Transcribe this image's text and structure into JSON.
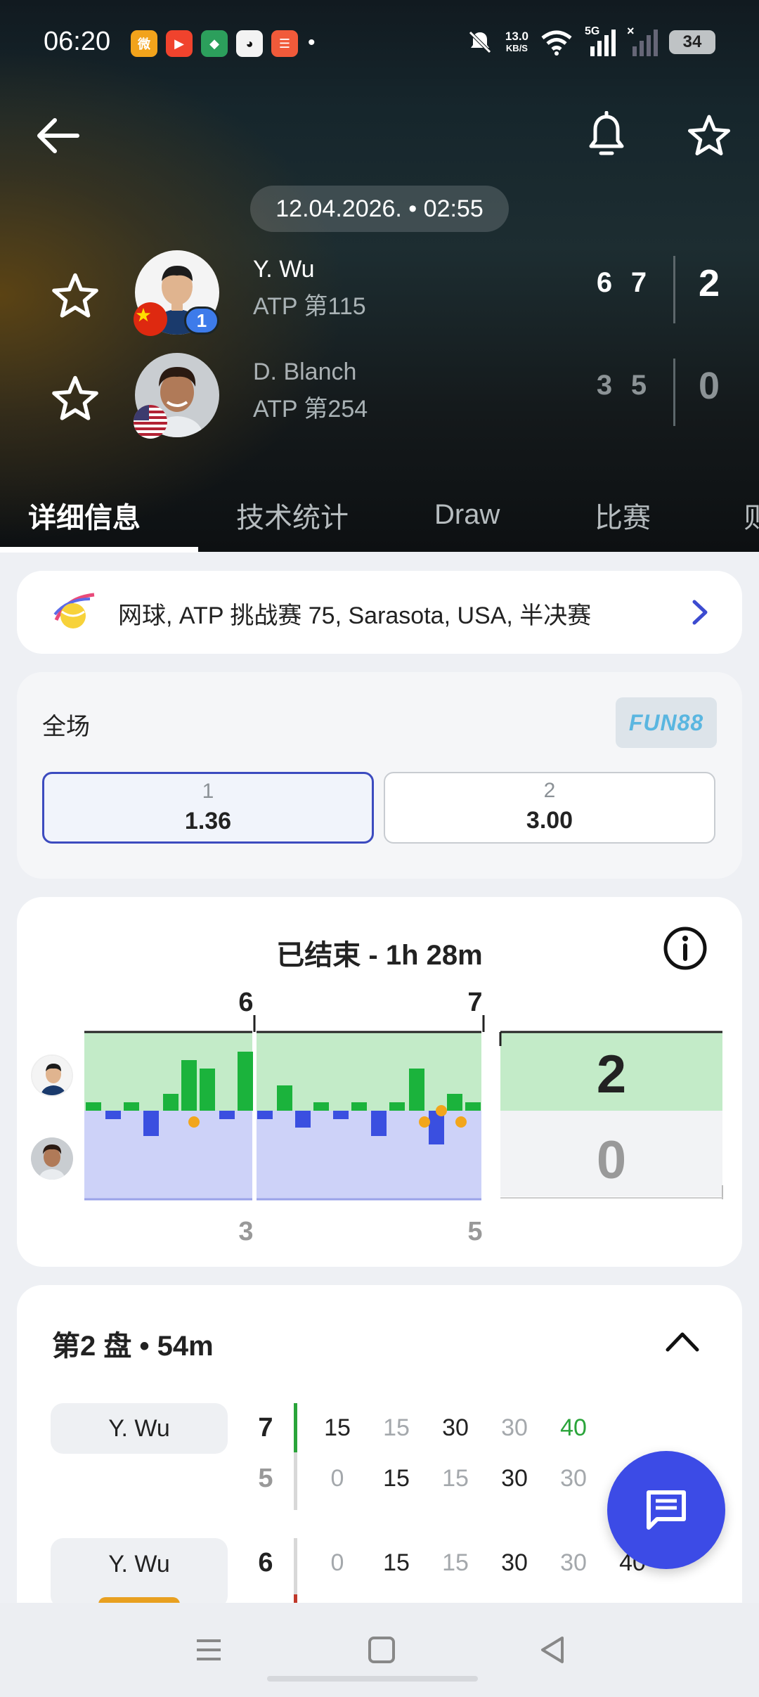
{
  "status_bar": {
    "time": "06:20",
    "apps": [
      "weibo-icon",
      "video-app-icon",
      "game-app-icon",
      "qq-icon",
      "xiaohongshu-icon"
    ],
    "net_speed_value": "13.0",
    "net_speed_unit": "KB/S",
    "network": "5G",
    "battery": "34"
  },
  "header": {
    "date": "12.04.2026. • 02:55"
  },
  "players": [
    {
      "name": "Y. Wu",
      "rank": "ATP 第115",
      "seed": "1",
      "flag": "china",
      "sets": [
        "6",
        "7"
      ],
      "total": "2"
    },
    {
      "name": "D. Blanch",
      "rank": "ATP 第254",
      "flag": "usa",
      "sets": [
        "3",
        "5"
      ],
      "total": "0"
    }
  ],
  "tabs": [
    "详细信息",
    "技术统计",
    "Draw",
    "比赛",
    "则"
  ],
  "league": {
    "text": "网球, ATP 挑战赛 75, Sarasota, USA, 半决赛"
  },
  "odds": {
    "title": "全场",
    "brand": "FUN88",
    "options": [
      {
        "label": "1",
        "value": "1.36",
        "selected": true
      },
      {
        "label": "2",
        "value": "3.00",
        "selected": false
      }
    ]
  },
  "momentum": {
    "title": "已结束 - 1h 28m",
    "sets_top": [
      "6",
      "7"
    ],
    "sets_bottom": [
      "3",
      "5"
    ],
    "score_top": "2",
    "score_bottom": "0",
    "colors": {
      "player1": "#1bb33c",
      "player2": "#3a4fe0",
      "p1_bg": "#c3ebc8",
      "p2_bg": "#cdd2f8"
    }
  },
  "set_detail": {
    "title": "第2 盘 • 54m",
    "games": [
      {
        "name": "Y. Wu",
        "score_top": "7",
        "score_bottom": "5",
        "bar_color": "#2aa43a",
        "points_top": [
          "15",
          "15",
          "30",
          "30",
          "40"
        ],
        "points_bottom": [
          "0",
          "15",
          "15",
          "30",
          "30"
        ]
      },
      {
        "name": "Y. Wu",
        "score_top": "6",
        "bar_color": "#c0392b",
        "points_top": [
          "0",
          "15",
          "15",
          "30",
          "30",
          "40"
        ]
      }
    ]
  }
}
